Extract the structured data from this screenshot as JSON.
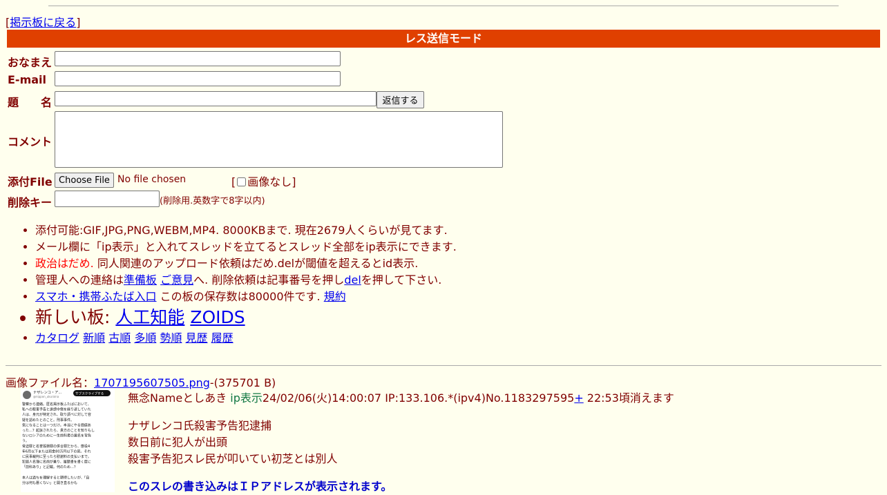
{
  "nav": {
    "back_open": "[",
    "back_link": "掲示板に戻る",
    "back_close": "]"
  },
  "form": {
    "mode_title": "レス送信モード",
    "name_label": "おなまえ",
    "email_label": "E-mail",
    "subject_label": "題　　名",
    "submit_label": "返信する",
    "comment_label": "コメント",
    "file_label": "添付File",
    "choose_file_label": "Choose File",
    "no_file_text": "No file chosen",
    "no_image_open": "[",
    "no_image_label": "画像なし",
    "no_image_close": "]",
    "delkey_label": "削除キー",
    "delkey_note": "(削除用.英数字で8字以内)"
  },
  "rules": {
    "r1": "添付可能:GIF,JPG,PNG,WEBM,MP4. 8000KBまで. 現在2679人くらいが見てます.",
    "r2": "メール欄に「ip表示」と入れてスレッドを立てるとスレッド全部をip表示にできます.",
    "r3_red": "政治はだめ.",
    "r3_rest": " 同人関連のアップロード依頼はだめ.delが閾値を超えるとid表示.",
    "r4_pre": "管理人への連絡は",
    "r4_link1": "準備板",
    "r4_link2": "ご意見",
    "r4_mid": "へ. 削除依頼は記事番号を押し",
    "r4_link3": "del",
    "r4_post": "を押して下さい.",
    "r5_link": "スマホ・携帯ふたば入口",
    "r5_mid": " この板の保存数は80000件です. ",
    "r5_link2": "規約",
    "r6_pre": "新しい板: ",
    "r6_link1": "人工知能",
    "r6_link2": "ZOIDS",
    "sort_links": [
      "カタログ",
      "新順",
      "古順",
      "多順",
      "勢順",
      "見歴",
      "履歴"
    ]
  },
  "post": {
    "file_prefix": "画像ファイル名：",
    "file_name": "1707195607505.png",
    "file_size": "-(375701 B)",
    "header_name": "無念Nameとしあき ",
    "header_ip_tag": "ip表示",
    "header_meta": "24/02/06(火)14:00:07 IP:133.106.*(ipv4)No.1183297595",
    "header_plus": "+",
    "header_expire": " 22:53頃消えます",
    "body_lines": [
      "ナザレンコ氏殺害予告犯逮捕",
      "数日前に犯人が出頭",
      "殺害予告犯スレ民が叩いてい初芝とは別人"
    ],
    "ip_notice": "このスレの書き込みはＩＰアドレスが表示されます。"
  },
  "thumbnail": {
    "account_name": "ナザレンコ・ア...",
    "handle": "@nippon_ukuraina",
    "subscribe": "サブスクライブする",
    "lines": [
      "警察から連絡。匿名掲示板ふたばにおいて、",
      "私への殺害予告と誹謗中傷を繰り返していた",
      "人は、身元が特定され、取り調べに対して容",
      "疑を認めたとのこと。刑事事件。",
      "気になることは一つだけ。本当にやる価値あ",
      "った…？起訴されたら、貴方のことを知りもし",
      "ないロシアのために一生前科者の悪名を背負",
      "う。",
      "脅迫罪と名誉毀損罪の併合罪だから、懲役4",
      "年6月以下または罰金80万円以下の罰。それ",
      "に民事裁判に至ったら慰謝料の支払いまで。",
      "犯罪人名簿に名前が乗り、履歴書を書く度に",
      "「前科あり」と記載。何のため…？",
      "",
      "本人は過ちを理解すると期待したいが、「自",
      "分は何も悪くない」と開き直るかも"
    ]
  }
}
